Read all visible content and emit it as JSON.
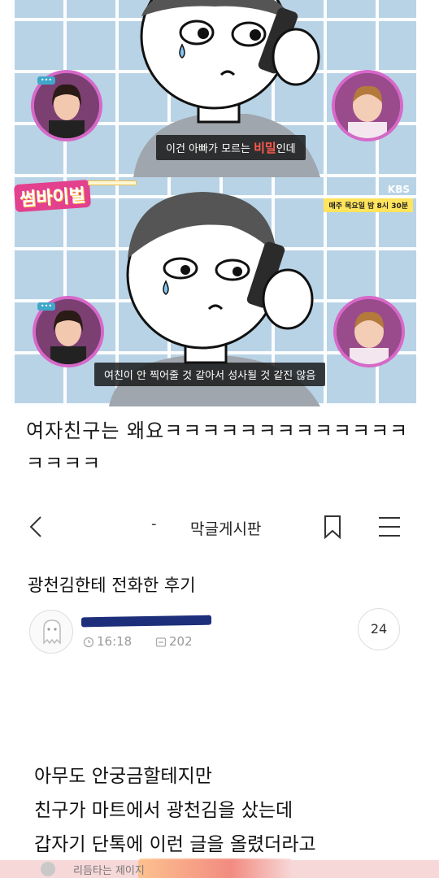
{
  "panel1": {
    "subtitle_pre": "이건 아빠가 모르는 ",
    "subtitle_highlight": "비밀",
    "subtitle_post": "인데"
  },
  "panel2": {
    "show_logo": "썸바이벌",
    "show_tag": "",
    "broadcaster": "KBS",
    "schedule": "매주 목요일 밤 8시 30분",
    "subtitle": "여친이 안 찍어줄 것 같아서 성사될 것 같진 않음"
  },
  "caption": "여자친구는 왜요ㅋㅋㅋㅋㅋㅋㅋㅋㅋㅋㅋㅋㅋㅋㅋㅋㅋ",
  "appbar": {
    "dash": "-",
    "board_name": "막글게시판",
    "icons": [
      "chevron-left-icon",
      "bookmark-icon",
      "menu-icon"
    ]
  },
  "post": {
    "title": "광천김한테 전화한 후기",
    "time": "16:18",
    "views": "202",
    "comments": "24",
    "body": [
      "아무도 안궁금할테지만",
      "친구가 마트에서 광천김을 샀는데",
      "갑자기 단톡에 이런 글을 올렸더라고"
    ],
    "embed_text": "리듬타는 제이지"
  },
  "colors": {
    "panel_bg": "#b9d3e6",
    "subtitle_highlight": "#ff5a4e",
    "redaction": "#1d2f7a",
    "guest_border": "#d668c8"
  }
}
